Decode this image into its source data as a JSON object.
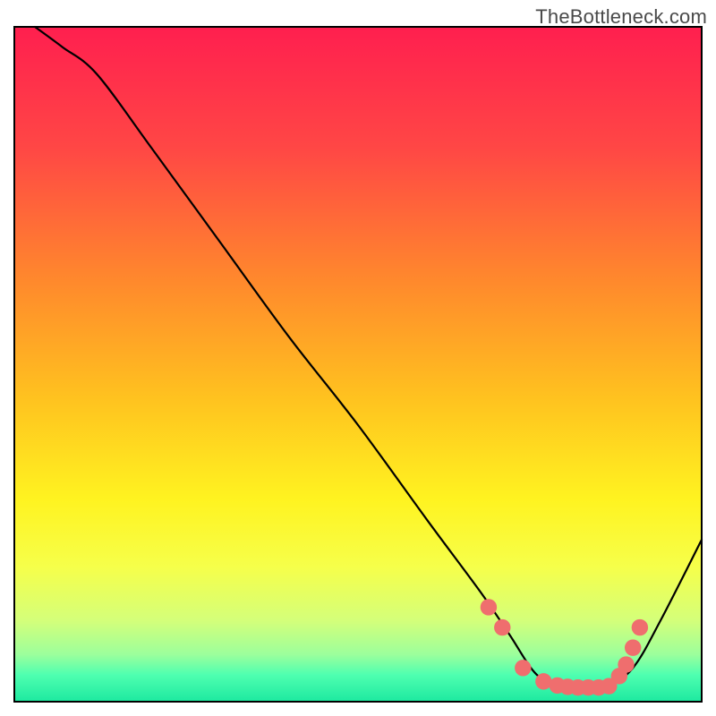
{
  "attribution": "TheBottleneck.com",
  "chart_data": {
    "type": "line",
    "title": "",
    "xlabel": "",
    "ylabel": "",
    "xlim": [
      0,
      100
    ],
    "ylim": [
      0,
      100
    ],
    "grid": false,
    "legend": false,
    "gradient_stops": [
      {
        "offset": 0,
        "color": "#ff1f4f"
      },
      {
        "offset": 18,
        "color": "#ff4745"
      },
      {
        "offset": 38,
        "color": "#ff8a2c"
      },
      {
        "offset": 55,
        "color": "#ffc21f"
      },
      {
        "offset": 70,
        "color": "#fff320"
      },
      {
        "offset": 80,
        "color": "#f6ff4a"
      },
      {
        "offset": 88,
        "color": "#d4ff7a"
      },
      {
        "offset": 93,
        "color": "#9cff9c"
      },
      {
        "offset": 96,
        "color": "#4fffb0"
      },
      {
        "offset": 100,
        "color": "#1de9a0"
      }
    ],
    "series": [
      {
        "name": "bottleneck-curve",
        "stroke": "#000000",
        "x": [
          3,
          7,
          12,
          20,
          30,
          40,
          50,
          60,
          68,
          72,
          76,
          80,
          83,
          86,
          90,
          94,
          100
        ],
        "values": [
          100,
          97,
          93,
          82,
          68,
          54,
          41,
          27,
          16,
          10,
          4,
          2,
          2,
          2,
          5,
          12,
          24
        ]
      }
    ],
    "markers": {
      "color": "#ef6e6e",
      "radius": 1.2,
      "x": [
        69,
        71,
        74,
        77,
        79,
        80.5,
        82,
        83.5,
        85,
        86.5,
        88,
        89,
        90,
        91
      ],
      "values": [
        14,
        11,
        5,
        3,
        2.4,
        2.2,
        2.1,
        2.1,
        2.1,
        2.3,
        3.8,
        5.5,
        8,
        11
      ]
    }
  }
}
